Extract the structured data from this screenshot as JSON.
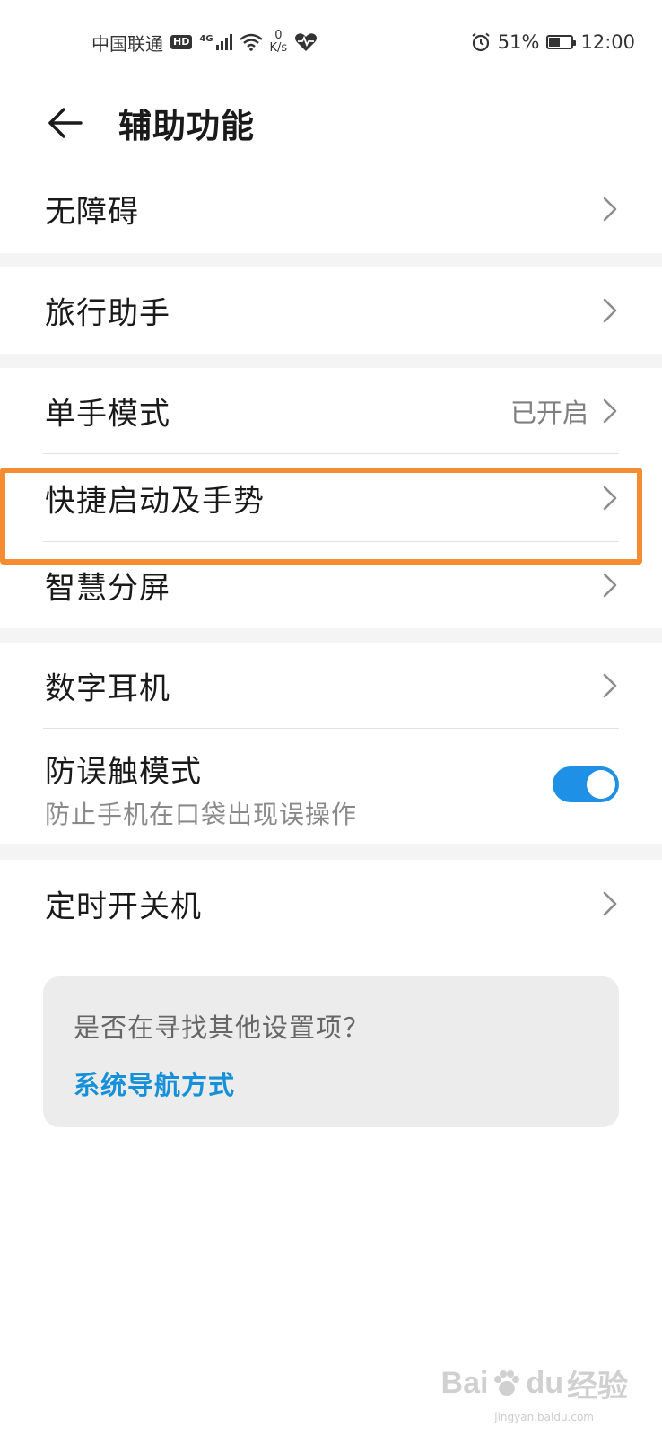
{
  "status_bar": {
    "carrier": "中国联通",
    "hd": "HD",
    "network": "4G",
    "speed_value": "0",
    "speed_unit": "K/s",
    "battery_percent": "51%",
    "battery_level": 0.51,
    "time": "12:00"
  },
  "header": {
    "title": "辅助功能"
  },
  "groups": {
    "g1": {
      "label": "无障碍"
    },
    "g2": {
      "label": "旅行助手"
    },
    "g3": {
      "one_hand_label": "单手模式",
      "one_hand_value": "已开启",
      "shortcut_label": "快捷启动及手势",
      "split_label": "智慧分屏"
    },
    "g4": {
      "headset_label": "数字耳机",
      "pocket_title": "防误触模式",
      "pocket_sub": "防止手机在口袋出现误操作",
      "pocket_enabled": true
    },
    "g5": {
      "label": "定时开关机"
    }
  },
  "card": {
    "question": "是否在寻找其他设置项？",
    "link": "系统导航方式"
  },
  "watermark": {
    "brand": "Bai",
    "brand_mid": "du",
    "brand_cn": "经验",
    "sub": "jingyan.baidu.com"
  },
  "colors": {
    "accent": "#1e90e6",
    "link": "#1690d8",
    "highlight": "#f58c32"
  }
}
